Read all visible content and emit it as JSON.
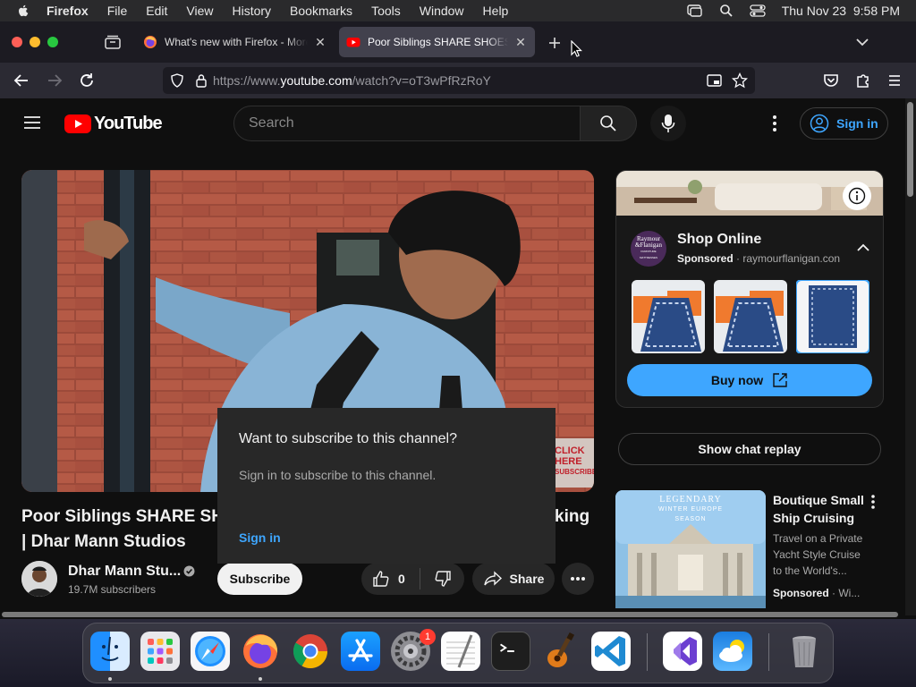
{
  "menubar": {
    "app": "Firefox",
    "items": [
      "File",
      "Edit",
      "View",
      "History",
      "Bookmarks",
      "Tools",
      "Window",
      "Help"
    ],
    "datetime": "Thu Nov 23  9:58 PM"
  },
  "tabs": [
    {
      "title": "What's new with Firefox - More",
      "icon": "firefox-icon",
      "active": false
    },
    {
      "title": "Poor Siblings SHARE SHOES for",
      "icon": "youtube-icon",
      "active": true
    }
  ],
  "urlbar": {
    "prefix": "https://www.",
    "domain": "youtube.com",
    "path": "/watch?v=oT3wPfRzRoY"
  },
  "youtube": {
    "logo_text": "YouTube",
    "search_placeholder": "Search",
    "sign_in": "Sign in",
    "video": {
      "title_line1": "Poor Siblings SHARE SHO",
      "title_line1_end": "king",
      "title_line2": "| Dhar Mann Studios",
      "thumbnail_overlay": [
        "CLICK",
        "HERE",
        "SUBSCRIBE"
      ]
    },
    "channel": {
      "name": "Dhar Mann Stu...",
      "subscribers": "19.7M subscribers",
      "subscribe_label": "Subscribe"
    },
    "actions": {
      "likes": "0",
      "share": "Share"
    },
    "popup": {
      "heading": "Want to subscribe to this channel?",
      "body": "Sign in to subscribe to this channel.",
      "link": "Sign in"
    },
    "ad": {
      "title": "Shop Online",
      "sponsored": "Sponsored",
      "domain": "raymourflanigan.con",
      "logo_text": [
        "Raymour",
        "&Flanigan",
        "FURNITURE",
        "MATTRESSES"
      ],
      "buy_now": "Buy now"
    },
    "chat_replay": "Show chat replay",
    "recommended": {
      "title_line1": "Boutique Small",
      "title_line2": "Ship Cruising",
      "desc": [
        "Travel on a Private",
        "Yacht Style Cruise",
        "to the World's..."
      ],
      "sponsored": "Sponsored",
      "suffix": "Wi...",
      "thumb_text": [
        "LEGENDARY",
        "WINTER EUROPE",
        "SEASON"
      ]
    }
  },
  "dock": {
    "badge_settings": "1",
    "apps": [
      "finder",
      "launchpad",
      "safari",
      "firefox",
      "chrome",
      "app-store",
      "system-settings",
      "textedit",
      "terminal",
      "garageband",
      "vscode",
      "visual-studio",
      "weather",
      "trash"
    ]
  }
}
